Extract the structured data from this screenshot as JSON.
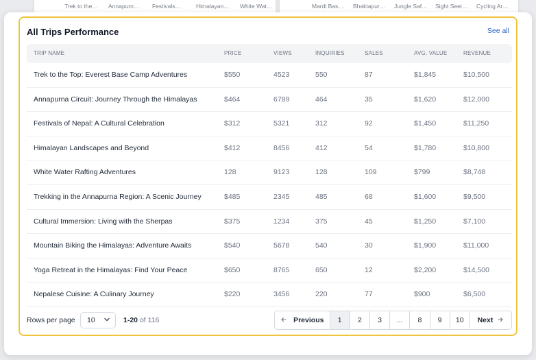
{
  "background_cards": {
    "left_labels": [
      "Trek to the…",
      "Annapurn…",
      "Festivals…",
      "Himalayan…",
      "White Wat…"
    ],
    "right_labels": [
      "Mardi Bas…",
      "Bhaktapur…",
      "Jungle Saf…",
      "Sight Seei…",
      "Cycling Ar…"
    ]
  },
  "card": {
    "title": "All Trips Performance",
    "see_all": "See all"
  },
  "table": {
    "columns": [
      "TRIP NAME",
      "PRICE",
      "VIEWS",
      "INQUIRIES",
      "SALES",
      "AVG. VALUE",
      "REVENUE"
    ],
    "rows": [
      [
        "Trek to the Top: Everest Base Camp Adventures",
        "$550",
        "4523",
        "550",
        "87",
        "$1,845",
        "$10,500"
      ],
      [
        "Annapurna Circuit: Journey Through the Himalayas",
        "$464",
        "6789",
        "464",
        "35",
        "$1,620",
        "$12,000"
      ],
      [
        "Festivals of Nepal: A Cultural Celebration",
        "$312",
        "5321",
        "312",
        "92",
        "$1,450",
        "$11,250"
      ],
      [
        "Himalayan Landscapes and Beyond",
        "$412",
        "8456",
        "412",
        "54",
        "$1,780",
        "$10,800"
      ],
      [
        "White Water Rafting Adventures",
        "128",
        "9123",
        "128",
        "109",
        "$799",
        "$8,748"
      ],
      [
        "Trekking in the Annapurna Region: A Scenic Journey",
        "$485",
        "2345",
        "485",
        "68",
        "$1,600",
        "$9,500"
      ],
      [
        "Cultural Immersion: Living with the Sherpas",
        "$375",
        "1234",
        "375",
        "45",
        "$1,250",
        "$7,100"
      ],
      [
        "Mountain Biking the Himalayas: Adventure Awaits",
        "$540",
        "5678",
        "540",
        "30",
        "$1,900",
        "$11,000"
      ],
      [
        "Yoga Retreat in the Himalayas: Find Your Peace",
        "$650",
        "8765",
        "650",
        "12",
        "$2,200",
        "$14,500"
      ],
      [
        "Nepalese Cuisine: A Culinary Journey",
        "$220",
        "3456",
        "220",
        "77",
        "$900",
        "$6,500"
      ]
    ]
  },
  "footer": {
    "rows_per_page_label": "Rows per page",
    "rows_per_page_value": "10",
    "range_main": "1-20",
    "range_of": "of 116",
    "previous": "Previous",
    "next": "Next",
    "pages": [
      "1",
      "2",
      "3",
      "...",
      "8",
      "9",
      "10"
    ],
    "active_page": "1"
  },
  "colors": {
    "accent_border": "#f0c53c",
    "link": "#2b63c9"
  },
  "icons": {
    "rows_select": "chevron-down-icon",
    "prev": "arrow-left-icon",
    "next": "arrow-right-icon"
  }
}
